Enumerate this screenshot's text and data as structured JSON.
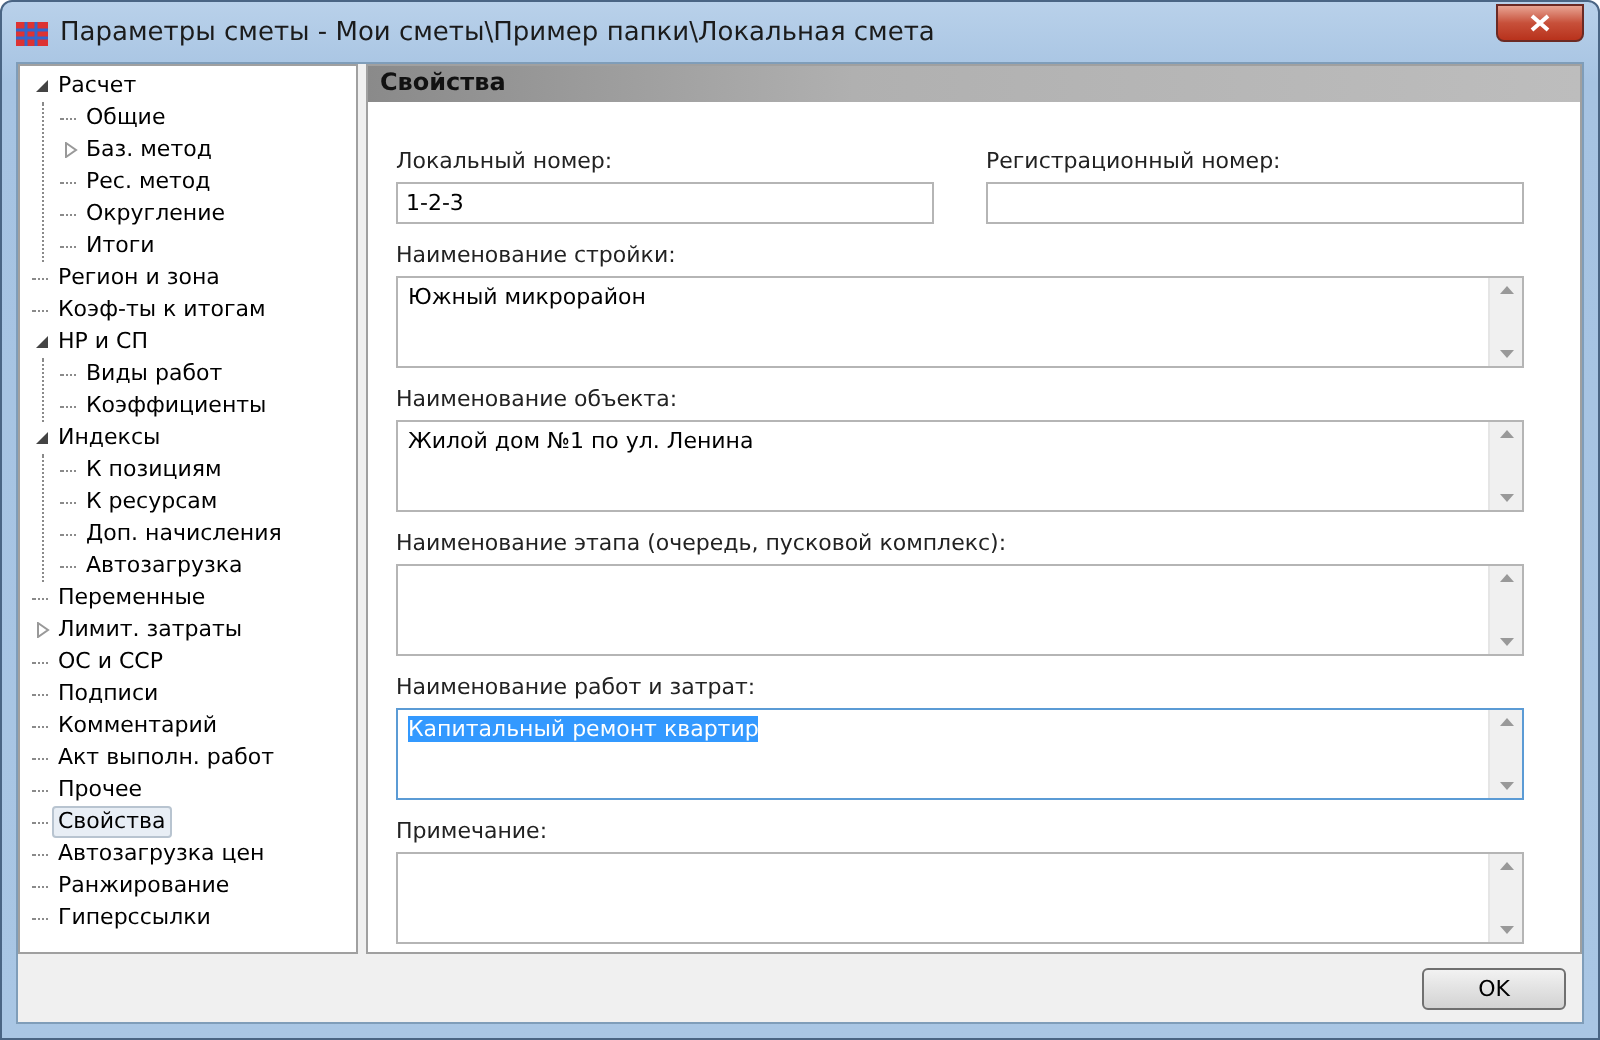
{
  "window": {
    "title": "Параметры сметы - Мои сметы\\Пример папки\\Локальная смета"
  },
  "tree": [
    {
      "label": "Расчет",
      "selected": false,
      "expanded": true,
      "children": [
        {
          "label": "Общие",
          "selected": false
        },
        {
          "label": "Баз. метод",
          "selected": false,
          "expanded": false
        },
        {
          "label": "Рес. метод",
          "selected": false
        },
        {
          "label": "Округление",
          "selected": false
        },
        {
          "label": "Итоги",
          "selected": false
        }
      ]
    },
    {
      "label": "Регион и зона",
      "selected": false
    },
    {
      "label": "Коэф-ты к итогам",
      "selected": false
    },
    {
      "label": "НР и СП",
      "selected": false,
      "expanded": true,
      "children": [
        {
          "label": "Виды работ",
          "selected": false
        },
        {
          "label": "Коэффициенты",
          "selected": false
        }
      ]
    },
    {
      "label": "Индексы",
      "selected": false,
      "expanded": true,
      "children": [
        {
          "label": "К позициям",
          "selected": false
        },
        {
          "label": "К ресурсам",
          "selected": false
        },
        {
          "label": "Доп. начисления",
          "selected": false
        },
        {
          "label": "Автозагрузка",
          "selected": false
        }
      ]
    },
    {
      "label": "Переменные",
      "selected": false
    },
    {
      "label": "Лимит. затраты",
      "selected": false,
      "expanded": false
    },
    {
      "label": "ОС и ССР",
      "selected": false
    },
    {
      "label": "Подписи",
      "selected": false
    },
    {
      "label": "Комментарий",
      "selected": false
    },
    {
      "label": "Акт выполн. работ",
      "selected": false
    },
    {
      "label": "Прочее",
      "selected": false
    },
    {
      "label": "Свойства",
      "selected": true
    },
    {
      "label": "Автозагрузка цен",
      "selected": false
    },
    {
      "label": "Ранжирование",
      "selected": false
    },
    {
      "label": "Гиперссылки",
      "selected": false
    }
  ],
  "panel": {
    "title": "Свойства",
    "short_fields": [
      {
        "label": "Локальный номер:",
        "value": "1-2-3"
      },
      {
        "label": "Регистрационный номер:"
      }
    ],
    "text_areas": [
      {
        "label": "Наименование стройки:",
        "value": "Южный микрорайон",
        "focused": false
      },
      {
        "label": "Наименование объекта:",
        "value": "Жилой дом №1 по ул. Ленина",
        "focused": false
      },
      {
        "label": "Наименование этапа (очередь, пусковой комплекс):",
        "focused": false
      },
      {
        "label": "Наименование работ и затрат:",
        "value": "Капитальный ремонт квартир",
        "focused": true,
        "text_selected": true
      },
      {
        "label": "Примечание:",
        "focused": false
      }
    ]
  },
  "buttons": [
    "OK"
  ]
}
